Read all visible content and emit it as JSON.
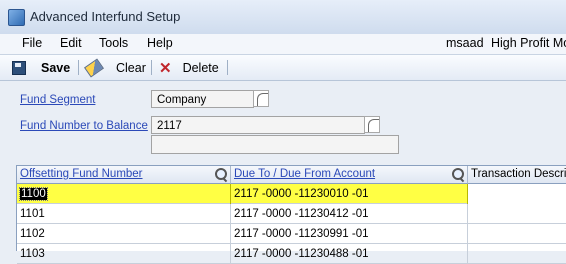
{
  "window": {
    "title": "Advanced Interfund Setup"
  },
  "menu": {
    "items": [
      "File",
      "Edit",
      "Tools",
      "Help"
    ],
    "user": "msaad",
    "company": "High Profit Mo"
  },
  "toolbar": {
    "save": "Save",
    "clear": "Clear",
    "delete": "Delete"
  },
  "form": {
    "fund_segment_label": "Fund Segment",
    "fund_segment_value": "Company",
    "fund_number_label": "Fund Number to Balance",
    "fund_number_value": "2117",
    "description_value": ""
  },
  "grid": {
    "headers": [
      "Offsetting Fund Number",
      "Due To / Due From Account",
      "Transaction Descript"
    ],
    "rows": [
      {
        "fund": "1100",
        "account": "2117 -0000 -11230010 -01",
        "desc": "",
        "selected": true
      },
      {
        "fund": "1101",
        "account": "2117 -0000 -11230412 -01",
        "desc": ""
      },
      {
        "fund": "1102",
        "account": "2117 -0000 -11230991 -01",
        "desc": ""
      },
      {
        "fund": "1103",
        "account": "2117 -0000 -11230488 -01",
        "desc": ""
      }
    ]
  }
}
